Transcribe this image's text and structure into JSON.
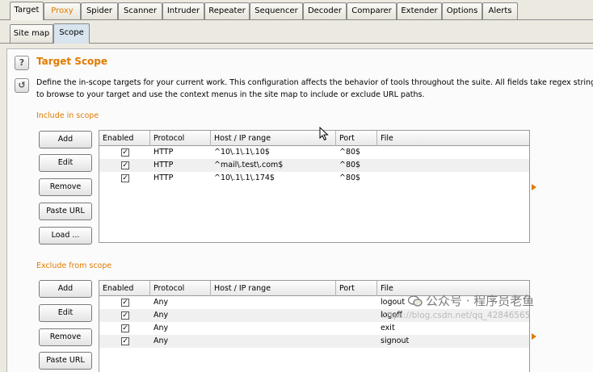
{
  "top_tabs": [
    {
      "label": "Target"
    },
    {
      "label": "Proxy"
    },
    {
      "label": "Spider"
    },
    {
      "label": "Scanner"
    },
    {
      "label": "Intruder"
    },
    {
      "label": "Repeater"
    },
    {
      "label": "Sequencer"
    },
    {
      "label": "Decoder"
    },
    {
      "label": "Comparer"
    },
    {
      "label": "Extender"
    },
    {
      "label": "Options"
    },
    {
      "label": "Alerts"
    }
  ],
  "sub_tabs": [
    {
      "label": "Site map"
    },
    {
      "label": "Scope"
    }
  ],
  "help_icon_glyph": "?",
  "refresh_icon_glyph": "↺",
  "title": "Target Scope",
  "description_line1": "Define the in-scope targets for your current work. This configuration affects the behavior of tools throughout the suite. All fields take regex strings. The easies",
  "description_line2": "to browse to your target and use the context menus in the site map to include or exclude URL paths.",
  "include": {
    "label": "Include in scope",
    "buttons": [
      "Add",
      "Edit",
      "Remove",
      "Paste URL",
      "Load ..."
    ],
    "columns": [
      "Enabled",
      "Protocol",
      "Host / IP range",
      "Port",
      "File"
    ],
    "rows": [
      {
        "enabled": "✓",
        "protocol": "HTTP",
        "host": "^10\\.1\\.1\\.10$",
        "port": "^80$",
        "file": ""
      },
      {
        "enabled": "✓",
        "protocol": "HTTP",
        "host": "^mail\\.test\\.com$",
        "port": "^80$",
        "file": ""
      },
      {
        "enabled": "✓",
        "protocol": "HTTP",
        "host": "^10\\.1\\.1\\.174$",
        "port": "^80$",
        "file": ""
      }
    ]
  },
  "exclude": {
    "label": "Exclude from scope",
    "buttons": [
      "Add",
      "Edit",
      "Remove",
      "Paste URL"
    ],
    "columns": [
      "Enabled",
      "Protocol",
      "Host / IP range",
      "Port",
      "File"
    ],
    "rows": [
      {
        "enabled": "✓",
        "protocol": "Any",
        "host": "",
        "port": "",
        "file": "logout"
      },
      {
        "enabled": "✓",
        "protocol": "Any",
        "host": "",
        "port": "",
        "file": "logoff"
      },
      {
        "enabled": "✓",
        "protocol": "Any",
        "host": "",
        "port": "",
        "file": "exit"
      },
      {
        "enabled": "✓",
        "protocol": "Any",
        "host": "",
        "port": "",
        "file": "signout"
      }
    ]
  },
  "watermark": "公众号 · 程序员老鱼",
  "watermark_url": "https://blog.csdn.net/qq_42846565",
  "colors": {
    "accent": "#e07b00",
    "active_subtab": "#d8e4ee"
  }
}
